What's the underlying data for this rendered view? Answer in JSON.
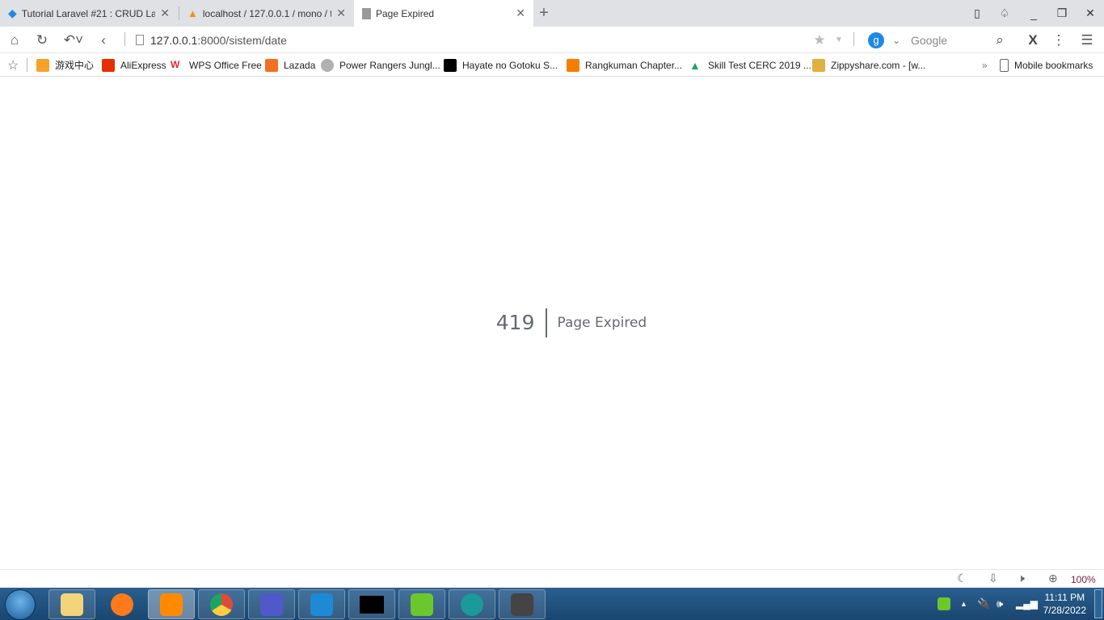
{
  "tabs": [
    {
      "title": "Tutorial Laravel #21 : CRUD Lar",
      "icon": "diamond-icon",
      "color": "#1e88e5"
    },
    {
      "title": "localhost / 127.0.0.1 / mono / t",
      "icon": "phpmyadmin-icon",
      "color": "#f29111"
    },
    {
      "title": "Page Expired",
      "icon": "page-icon",
      "active": true
    }
  ],
  "address": {
    "host": "127.0.0.1",
    "rest": ":8000/sistem/date"
  },
  "search": {
    "engine": "Google"
  },
  "bookmarks": [
    {
      "label": "游戏中心",
      "color": "#f7a12a"
    },
    {
      "label": "AliExpress",
      "color": "#e62e04"
    },
    {
      "label": "WPS Office Free",
      "color": "#e0282e"
    },
    {
      "label": "Lazada",
      "color": "#f36f21"
    },
    {
      "label": "Power Rangers Jungl...",
      "color": "#b0b0b0"
    },
    {
      "label": "Hayate no Gotoku S...",
      "color": "#000000"
    },
    {
      "label": "Rangkuman Chapter...",
      "color": "#f57d00"
    },
    {
      "label": "Skill Test CERC 2019 ...",
      "color": "#1fa463"
    },
    {
      "label": "Zippyshare.com - [w...",
      "color": "#e0b040"
    }
  ],
  "more_label": "»",
  "mobile_bookmarks": "Mobile bookmarks",
  "error": {
    "code": "419",
    "message": "Page Expired"
  },
  "status": {
    "zoom": "100%"
  },
  "taskbar": {
    "apps": [
      {
        "name": "file-explorer",
        "color": "#f3d47b"
      },
      {
        "name": "firefox",
        "color": "#ff7a1a"
      },
      {
        "name": "uc-browser",
        "color": "#ff8a00",
        "highlight": true
      },
      {
        "name": "chrome",
        "color": "#dd4b39"
      },
      {
        "name": "teams",
        "color": "#5059c9"
      },
      {
        "name": "vscode",
        "color": "#1e8ad6"
      },
      {
        "name": "cmd",
        "color": "#000000"
      },
      {
        "name": "wifi-app",
        "color": "#6cc72d"
      },
      {
        "name": "eset",
        "color": "#1a9a9a"
      },
      {
        "name": "sublime-text",
        "color": "#444444"
      }
    ],
    "time": "11:11 PM",
    "date": "7/28/2022"
  }
}
